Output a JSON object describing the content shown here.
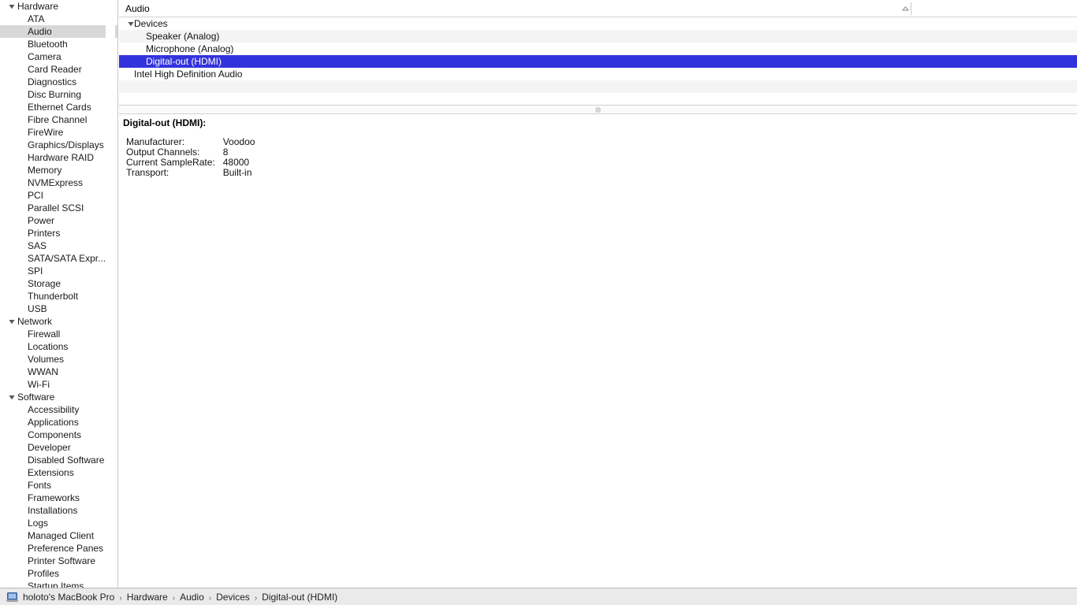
{
  "sidebar": {
    "items": [
      {
        "label": "Hardware",
        "type": "group",
        "expanded": true
      },
      {
        "label": "ATA",
        "type": "child"
      },
      {
        "label": "Audio",
        "type": "child",
        "selected": true
      },
      {
        "label": "Bluetooth",
        "type": "child"
      },
      {
        "label": "Camera",
        "type": "child"
      },
      {
        "label": "Card Reader",
        "type": "child"
      },
      {
        "label": "Diagnostics",
        "type": "child"
      },
      {
        "label": "Disc Burning",
        "type": "child"
      },
      {
        "label": "Ethernet Cards",
        "type": "child"
      },
      {
        "label": "Fibre Channel",
        "type": "child"
      },
      {
        "label": "FireWire",
        "type": "child"
      },
      {
        "label": "Graphics/Displays",
        "type": "child"
      },
      {
        "label": "Hardware RAID",
        "type": "child"
      },
      {
        "label": "Memory",
        "type": "child"
      },
      {
        "label": "NVMExpress",
        "type": "child"
      },
      {
        "label": "PCI",
        "type": "child"
      },
      {
        "label": "Parallel SCSI",
        "type": "child"
      },
      {
        "label": "Power",
        "type": "child"
      },
      {
        "label": "Printers",
        "type": "child"
      },
      {
        "label": "SAS",
        "type": "child"
      },
      {
        "label": "SATA/SATA Expr...",
        "type": "child"
      },
      {
        "label": "SPI",
        "type": "child"
      },
      {
        "label": "Storage",
        "type": "child"
      },
      {
        "label": "Thunderbolt",
        "type": "child"
      },
      {
        "label": "USB",
        "type": "child"
      },
      {
        "label": "Network",
        "type": "group",
        "expanded": true
      },
      {
        "label": "Firewall",
        "type": "child"
      },
      {
        "label": "Locations",
        "type": "child"
      },
      {
        "label": "Volumes",
        "type": "child"
      },
      {
        "label": "WWAN",
        "type": "child"
      },
      {
        "label": "Wi-Fi",
        "type": "child"
      },
      {
        "label": "Software",
        "type": "group",
        "expanded": true
      },
      {
        "label": "Accessibility",
        "type": "child"
      },
      {
        "label": "Applications",
        "type": "child"
      },
      {
        "label": "Components",
        "type": "child"
      },
      {
        "label": "Developer",
        "type": "child"
      },
      {
        "label": "Disabled Software",
        "type": "child"
      },
      {
        "label": "Extensions",
        "type": "child"
      },
      {
        "label": "Fonts",
        "type": "child"
      },
      {
        "label": "Frameworks",
        "type": "child"
      },
      {
        "label": "Installations",
        "type": "child"
      },
      {
        "label": "Logs",
        "type": "child"
      },
      {
        "label": "Managed Client",
        "type": "child"
      },
      {
        "label": "Preference Panes",
        "type": "child"
      },
      {
        "label": "Printer Software",
        "type": "child"
      },
      {
        "label": "Profiles",
        "type": "child"
      },
      {
        "label": "Startup Items",
        "type": "child"
      }
    ]
  },
  "list": {
    "header": {
      "title": "Audio",
      "sort_icon": "chevron-up-icon"
    },
    "rows": [
      {
        "label": "Devices",
        "level": 1,
        "expanded": true,
        "selected": false
      },
      {
        "label": "Speaker (Analog)",
        "level": 2,
        "selected": false
      },
      {
        "label": "Microphone (Analog)",
        "level": 2,
        "selected": false
      },
      {
        "label": "Digital-out (HDMI)",
        "level": 2,
        "selected": true
      },
      {
        "label": "Intel High Definition Audio",
        "level": 1,
        "selected": false
      },
      {
        "label": "",
        "level": 0,
        "selected": false
      },
      {
        "label": "",
        "level": 0,
        "selected": false
      }
    ]
  },
  "detail": {
    "title": "Digital-out (HDMI):",
    "fields": [
      {
        "key": "Manufacturer:",
        "value": "Voodoo"
      },
      {
        "key": "Output Channels:",
        "value": "8"
      },
      {
        "key": "Current SampleRate:",
        "value": "48000"
      },
      {
        "key": "Transport:",
        "value": "Built-in"
      }
    ]
  },
  "bottombar": {
    "icon": "macbook-icon",
    "crumbs": [
      "holoto's MacBook Pro",
      "Hardware",
      "Audio",
      "Devices",
      "Digital-out (HDMI)"
    ],
    "separator": "›"
  },
  "colors": {
    "selection_blue": "#3333dd",
    "sidebar_selection": "#d8d8d8",
    "row_stripe": "#f4f4f5",
    "bottombar_bg": "#eaeaea"
  }
}
